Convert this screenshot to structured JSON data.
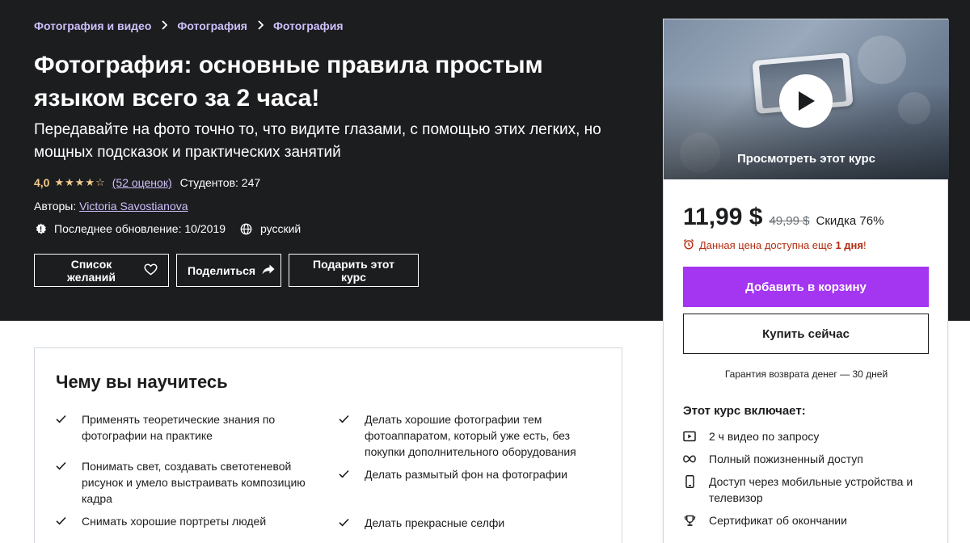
{
  "breadcrumb": {
    "items": [
      "Фотография и видео",
      "Фотография",
      "Фотография"
    ]
  },
  "course": {
    "title": "Фотография: основные правила простым языком всего за 2 часа!",
    "subtitle": "Передавайте на фото точно то, что видите глазами, с помощью этих легких, но мощных подсказок и практических занятий",
    "rating": "4,0",
    "stars": "★★★★☆",
    "reviews": "(52 оценок)",
    "students": "Студентов: 247",
    "authors_label": "Авторы:",
    "author": "Victoria Savostianova",
    "updated": "Последнее обновление: 10/2019",
    "language": "русский"
  },
  "actions": {
    "wishlist": "Список желаний",
    "share": "Поделиться",
    "gift": "Подарить этот курс"
  },
  "card": {
    "preview_label": "Просмотреть этот курс",
    "price": "11,99 $",
    "old_price": "49,99 $",
    "discount": "Скидка 76%",
    "timer_prefix": "Данная цена доступна еще",
    "timer_bold": "1 дня",
    "timer_suffix": "!",
    "add_to_cart": "Добавить в корзину",
    "buy_now": "Купить сейчас",
    "guarantee": "Гарантия возврата денег — 30 дней",
    "includes_title": "Этот курс включает:",
    "includes": [
      {
        "icon": "video-icon",
        "text": "2 ч видео по запросу"
      },
      {
        "icon": "infinity-icon",
        "text": "Полный пожизненный доступ"
      },
      {
        "icon": "mobile-icon",
        "text": "Доступ через мобильные устройства и телевизор"
      },
      {
        "icon": "trophy-icon",
        "text": "Сертификат об окончании"
      }
    ]
  },
  "learn": {
    "title": "Чему вы научитесь",
    "left": [
      "Применять теоретические знания по фотографии на практике",
      "Понимать свет, создавать светотеневой рисунок и умело выстраивать композицию кадра",
      "Снимать хорошие портреты людей"
    ],
    "right": [
      "Делать хорошие фотографии тем фотоаппаратом, который уже есть, без покупки дополнительного оборудования",
      "Делать размытый фон на фотографии",
      "Делать прекрасные селфи"
    ]
  },
  "colors": {
    "hero_bg": "#1c1d1f",
    "link_purple": "#cec0fc",
    "star_gold": "#f3ca8c",
    "cta_purple": "#a435f0",
    "timer_red": "#b32d0f"
  }
}
